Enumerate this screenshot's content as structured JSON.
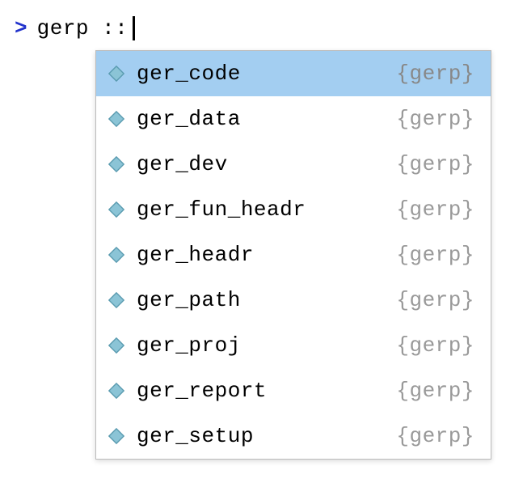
{
  "console": {
    "prompt_char": ">",
    "typed": "gerp ::"
  },
  "completion": {
    "items": [
      {
        "name": "ger_code",
        "package": "{gerp}",
        "selected": true
      },
      {
        "name": "ger_data",
        "package": "{gerp}",
        "selected": false
      },
      {
        "name": "ger_dev",
        "package": "{gerp}",
        "selected": false
      },
      {
        "name": "ger_fun_headr",
        "package": "{gerp}",
        "selected": false
      },
      {
        "name": "ger_headr",
        "package": "{gerp}",
        "selected": false
      },
      {
        "name": "ger_path",
        "package": "{gerp}",
        "selected": false
      },
      {
        "name": "ger_proj",
        "package": "{gerp}",
        "selected": false
      },
      {
        "name": "ger_report",
        "package": "{gerp}",
        "selected": false
      },
      {
        "name": "ger_setup",
        "package": "{gerp}",
        "selected": false
      }
    ]
  }
}
